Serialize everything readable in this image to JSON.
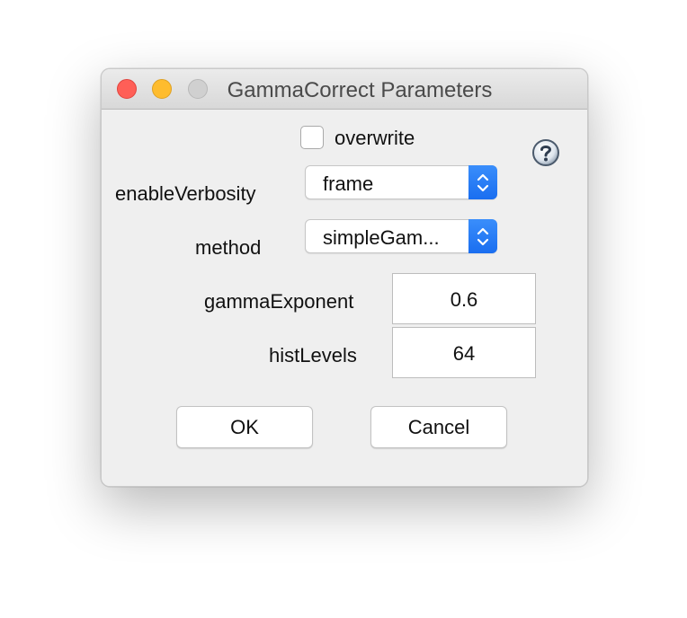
{
  "window": {
    "title": "GammaCorrect Parameters"
  },
  "form": {
    "overwrite": {
      "label": "overwrite",
      "checked": false
    },
    "enableVerbosity": {
      "label": "enableVerbosity",
      "value": "frame"
    },
    "method": {
      "label": "method",
      "value": "simpleGam..."
    },
    "gammaExponent": {
      "label": "gammaExponent",
      "value": "0.6"
    },
    "histLevels": {
      "label": "histLevels",
      "value": "64"
    }
  },
  "buttons": {
    "ok": "OK",
    "cancel": "Cancel"
  },
  "colors": {
    "accent": "#2a7ff6",
    "close": "#ff5f57",
    "minimize": "#febc2e",
    "zoom_disabled": "#d0d0d0"
  },
  "icons": {
    "help": "help-question-icon",
    "stepper": "chevron-up-down-icon"
  }
}
